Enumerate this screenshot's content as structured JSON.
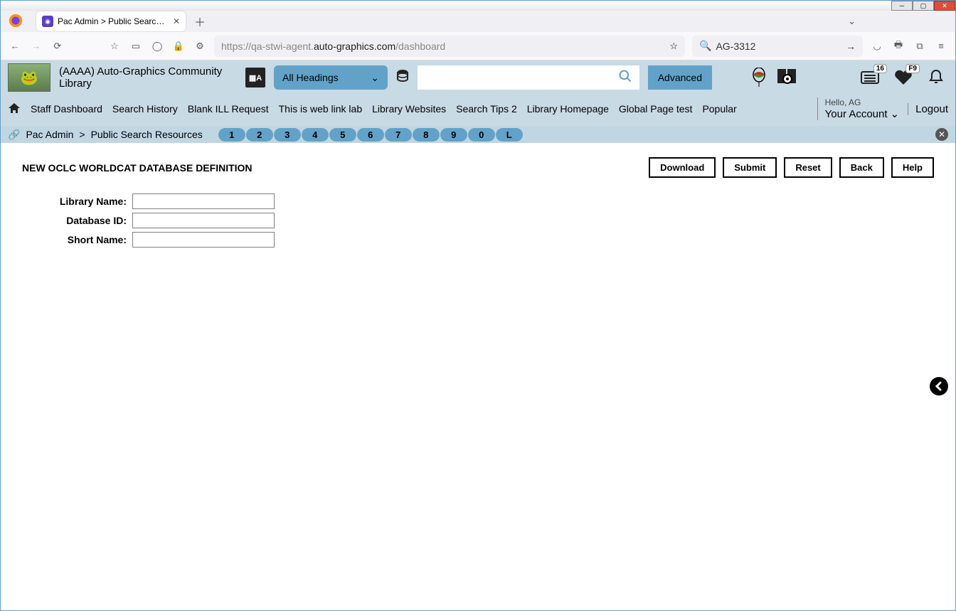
{
  "browser": {
    "tab_title": "Pac Admin > Public Search Res",
    "url_prefix": "https://qa-stwi-agent.",
    "url_domain": "auto-graphics.com",
    "url_suffix": "/dashboard",
    "search_value": "AG-3312"
  },
  "header": {
    "org_name": "(AAAA) Auto-Graphics Community Library",
    "search_type": "All Headings",
    "advanced": "Advanced",
    "badge_list": "16",
    "badge_heart": "F9",
    "greeting": "Hello, AG",
    "account": "Your Account",
    "logout": "Logout"
  },
  "nav": {
    "items": [
      "Staff Dashboard",
      "Search History",
      "Blank ILL Request",
      "This is web link lab",
      "Library Websites",
      "Search Tips 2",
      "Library Homepage",
      "Global Page test",
      "Popular"
    ]
  },
  "breadcrumb": {
    "part1": "Pac Admin",
    "part2": "Public Search Resources",
    "pills": [
      "1",
      "2",
      "3",
      "4",
      "5",
      "6",
      "7",
      "8",
      "9",
      "0",
      "L"
    ]
  },
  "page": {
    "title": "NEW OCLC WORLDCAT DATABASE DEFINITION",
    "buttons": {
      "download": "Download",
      "submit": "Submit",
      "reset": "Reset",
      "back": "Back",
      "help": "Help"
    },
    "form": {
      "library_name_label": "Library Name:",
      "library_name_value": "",
      "database_id_label": "Database ID:",
      "database_id_value": "",
      "short_name_label": "Short Name:",
      "short_name_value": ""
    }
  }
}
